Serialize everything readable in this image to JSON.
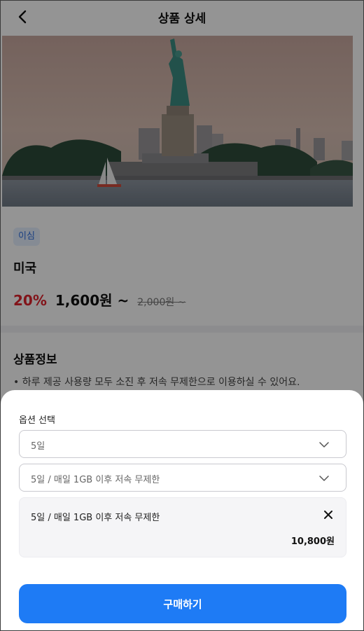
{
  "header": {
    "title": "상품 상세"
  },
  "product": {
    "type_badge": "이심",
    "name": "미국",
    "discount": "20%",
    "price": "1,600원 ~",
    "original_price": "2,000원 ~"
  },
  "info": {
    "title": "상품정보",
    "bullet": "• 하루 제공 사용량 모두 소진 후 저속 무제한으로 이용하실 수 있어요."
  },
  "sheet": {
    "title": "옵션 선택",
    "select_days": "5일",
    "select_plan": "5일 / 매일 1GB 이후 저속 무제한",
    "selected_option": {
      "label": "5일 / 매일 1GB 이후 저속 무제한",
      "price": "10,800원"
    },
    "buy_label": "구매하기"
  },
  "colors": {
    "accent": "#1e7bf5",
    "discount": "#e0242e",
    "badge_bg": "#e6f0ff",
    "badge_text": "#2f6fe0"
  }
}
